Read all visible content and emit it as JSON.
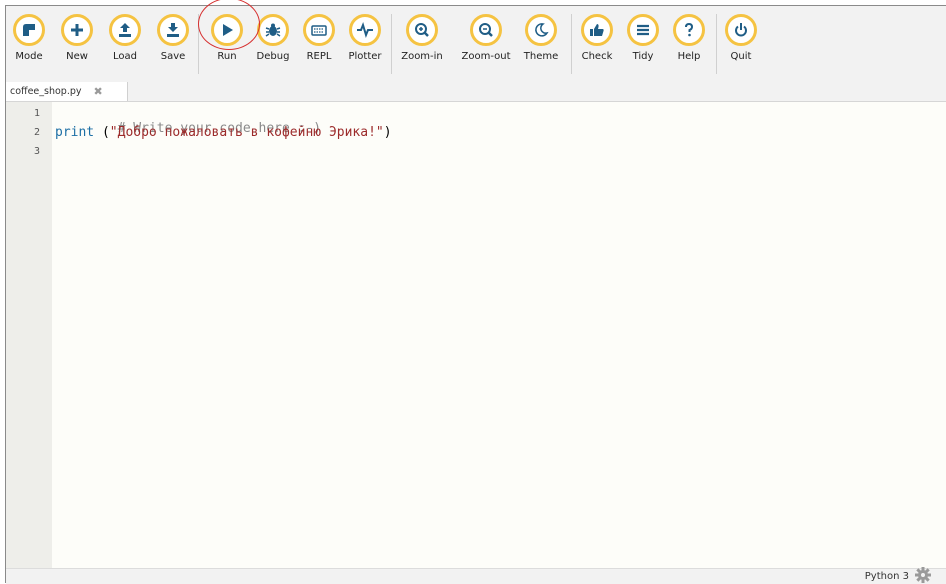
{
  "toolbar": {
    "buttons": [
      {
        "id": "mode",
        "label": "Mode",
        "icon": "mode-icon"
      },
      {
        "id": "new",
        "label": "New",
        "icon": "plus-icon"
      },
      {
        "id": "load",
        "label": "Load",
        "icon": "upload-icon"
      },
      {
        "id": "save",
        "label": "Save",
        "icon": "download-icon"
      },
      {
        "id": "run",
        "label": "Run",
        "icon": "play-icon"
      },
      {
        "id": "debug",
        "label": "Debug",
        "icon": "bug-icon"
      },
      {
        "id": "repl",
        "label": "REPL",
        "icon": "keyboard-icon"
      },
      {
        "id": "plotter",
        "label": "Plotter",
        "icon": "pulse-icon"
      },
      {
        "id": "zoom-in",
        "label": "Zoom-in",
        "icon": "zoom-in-icon"
      },
      {
        "id": "zoom-out",
        "label": "Zoom-out",
        "icon": "zoom-out-icon"
      },
      {
        "id": "theme",
        "label": "Theme",
        "icon": "moon-icon"
      },
      {
        "id": "check",
        "label": "Check",
        "icon": "thumbs-up-icon"
      },
      {
        "id": "tidy",
        "label": "Tidy",
        "icon": "lines-icon"
      },
      {
        "id": "help",
        "label": "Help",
        "icon": "question-icon"
      },
      {
        "id": "quit",
        "label": "Quit",
        "icon": "power-icon"
      }
    ],
    "highlighted_button": "run"
  },
  "tab": {
    "filename": "coffee_shop.py",
    "close_glyph": "✖"
  },
  "editor": {
    "line_numbers": [
      "1",
      "2",
      "3"
    ],
    "line1_comment": "# Write your code here :-)",
    "line2_keyword": "print",
    "line2_open": " (",
    "line2_string": "\"Добро пожаловать в кофейню Эрика!\"",
    "line2_close": ")",
    "line3": ""
  },
  "status": {
    "mode_text": "Python 3",
    "settings_icon": "gear-icon"
  },
  "colors": {
    "button_ring": "#f5c342",
    "icon_blue": "#1f5d86",
    "highlight_circle": "#d62f2f",
    "keyword": "#1d6fa5",
    "string": "#9c2b2b",
    "comment": "#8a8a8a"
  }
}
